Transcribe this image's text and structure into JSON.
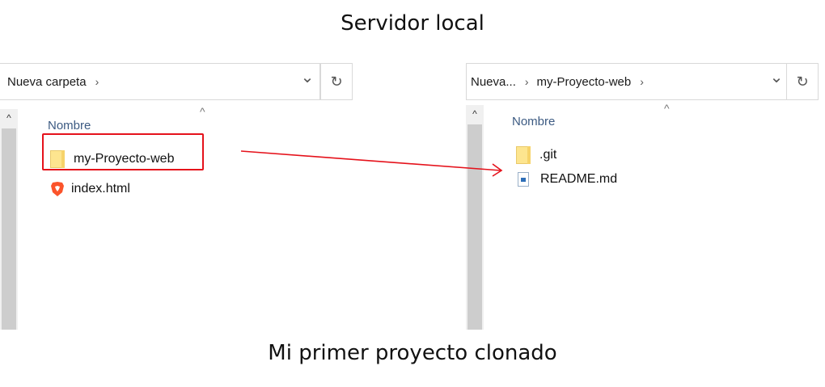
{
  "captions": {
    "top": "Servidor local",
    "bottom": "Mi primer proyecto clonado"
  },
  "left_window": {
    "breadcrumb": [
      "Nueva carpeta"
    ],
    "column_header": "Nombre",
    "files": [
      {
        "name": "my-Proyecto-web",
        "icon": "folder-icon"
      },
      {
        "name": "index.html",
        "icon": "brave-browser-icon"
      }
    ]
  },
  "right_window": {
    "breadcrumb": [
      "Nueva...",
      "my-Proyecto-web"
    ],
    "column_header": "Nombre",
    "files": [
      {
        "name": ".git",
        "icon": "folder-icon"
      },
      {
        "name": "README.md",
        "icon": "markdown-file-icon"
      }
    ]
  },
  "icons": {
    "chevron": "›",
    "dropdown": "⌄",
    "refresh": "↻",
    "sort_up": "^",
    "scroll_up": "^"
  },
  "colors": {
    "highlight": "#e5121b",
    "header_text": "#3c5a82"
  }
}
